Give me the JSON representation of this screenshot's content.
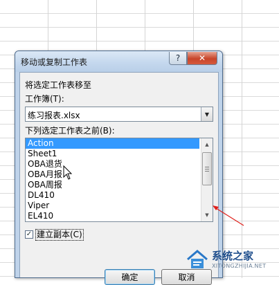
{
  "dialog": {
    "title": "移动或复制工作表",
    "help_label": "?",
    "close_label": "✕",
    "move_label": "将选定工作表移至",
    "workbook_label": "工作簿(T):",
    "workbook_value": "练习报表.xlsx",
    "before_label": "下列选定工作表之前(B):",
    "sheets": [
      "Action",
      "Sheet1",
      "OBA退货",
      "OBA月报",
      "OBA周报",
      "DL410",
      "Viper",
      "EL410"
    ],
    "selected_sheet": "Action",
    "copy_label": "建立副本(C)",
    "copy_checked": true,
    "ok_label": "确定",
    "cancel_label": "取消"
  },
  "watermark": {
    "title": "系统之家",
    "url": "XITONGZHIJIA.NET"
  },
  "colors": {
    "selection": "#3399ff",
    "annotation_arrow": "#e0201b",
    "title_bar": "#c5d8ee"
  }
}
